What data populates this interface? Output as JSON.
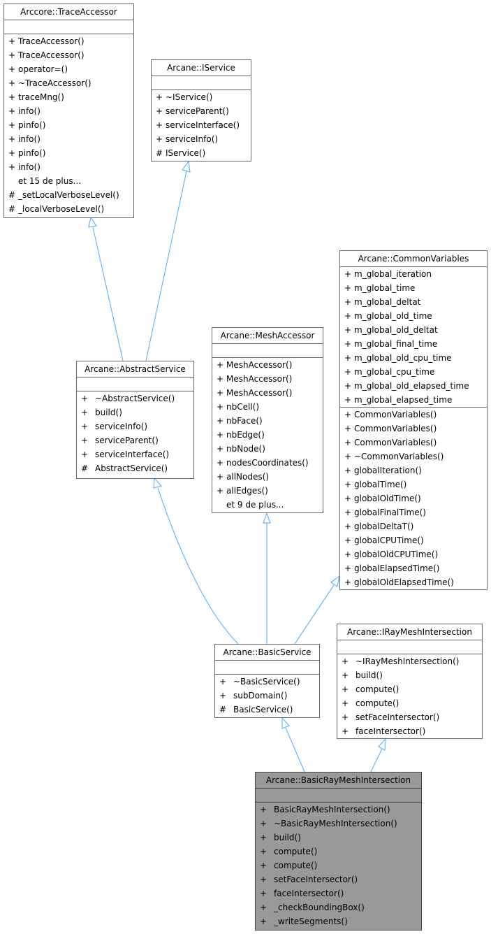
{
  "diagram": {
    "type": "class-inheritance",
    "edge_color": "#63b8ff",
    "classes": {
      "trace_accessor": {
        "name": "Arccore::TraceAccessor",
        "attributes": [],
        "methods": [
          {
            "vis": "+",
            "name": "TraceAccessor()"
          },
          {
            "vis": "+",
            "name": "TraceAccessor()"
          },
          {
            "vis": "+",
            "name": "operator=()"
          },
          {
            "vis": "+",
            "name": "~TraceAccessor()"
          },
          {
            "vis": "+",
            "name": "traceMng()"
          },
          {
            "vis": "+",
            "name": "info()"
          },
          {
            "vis": "+",
            "name": "pinfo()"
          },
          {
            "vis": "+",
            "name": "info()"
          },
          {
            "vis": "+",
            "name": "pinfo()"
          },
          {
            "vis": "+",
            "name": "info()"
          },
          {
            "vis": "",
            "name": "et 15 de plus..."
          },
          {
            "vis": "#",
            "name": "_setLocalVerboseLevel()"
          },
          {
            "vis": "#",
            "name": "_localVerboseLevel()"
          }
        ]
      },
      "iservice": {
        "name": "Arcane::IService",
        "attributes": [],
        "methods": [
          {
            "vis": "+",
            "name": "~IService()"
          },
          {
            "vis": "+",
            "name": "serviceParent()"
          },
          {
            "vis": "+",
            "name": "serviceInterface()"
          },
          {
            "vis": "+",
            "name": "serviceInfo()"
          },
          {
            "vis": "#",
            "name": "IService()"
          }
        ]
      },
      "common_variables": {
        "name": "Arcane::CommonVariables",
        "attributes": [
          {
            "vis": "+",
            "name": "m_global_iteration"
          },
          {
            "vis": "+",
            "name": "m_global_time"
          },
          {
            "vis": "+",
            "name": "m_global_deltat"
          },
          {
            "vis": "+",
            "name": "m_global_old_time"
          },
          {
            "vis": "+",
            "name": "m_global_old_deltat"
          },
          {
            "vis": "+",
            "name": "m_global_final_time"
          },
          {
            "vis": "+",
            "name": "m_global_old_cpu_time"
          },
          {
            "vis": "+",
            "name": "m_global_cpu_time"
          },
          {
            "vis": "+",
            "name": "m_global_old_elapsed_time"
          },
          {
            "vis": "+",
            "name": "m_global_elapsed_time"
          }
        ],
        "methods": [
          {
            "vis": "+",
            "name": "CommonVariables()"
          },
          {
            "vis": "+",
            "name": "CommonVariables()"
          },
          {
            "vis": "+",
            "name": "CommonVariables()"
          },
          {
            "vis": "+",
            "name": "~CommonVariables()"
          },
          {
            "vis": "+",
            "name": "globalIteration()"
          },
          {
            "vis": "+",
            "name": "globalTime()"
          },
          {
            "vis": "+",
            "name": "globalOldTime()"
          },
          {
            "vis": "+",
            "name": "globalFinalTime()"
          },
          {
            "vis": "+",
            "name": "globalDeltaT()"
          },
          {
            "vis": "+",
            "name": "globalCPUTime()"
          },
          {
            "vis": "+",
            "name": "globalOldCPUTime()"
          },
          {
            "vis": "+",
            "name": "globalElapsedTime()"
          },
          {
            "vis": "+",
            "name": "globalOldElapsedTime()"
          }
        ]
      },
      "mesh_accessor": {
        "name": "Arcane::MeshAccessor",
        "attributes": [],
        "methods": [
          {
            "vis": "+",
            "name": "MeshAccessor()"
          },
          {
            "vis": "+",
            "name": "MeshAccessor()"
          },
          {
            "vis": "+",
            "name": "MeshAccessor()"
          },
          {
            "vis": "+",
            "name": "nbCell()"
          },
          {
            "vis": "+",
            "name": "nbFace()"
          },
          {
            "vis": "+",
            "name": "nbEdge()"
          },
          {
            "vis": "+",
            "name": "nbNode()"
          },
          {
            "vis": "+",
            "name": "nodesCoordinates()"
          },
          {
            "vis": "+",
            "name": "allNodes()"
          },
          {
            "vis": "+",
            "name": "allEdges()"
          },
          {
            "vis": "",
            "name": "et 9 de plus..."
          }
        ]
      },
      "abstract_service": {
        "name": "Arcane::AbstractService",
        "attributes": [],
        "methods": [
          {
            "vis": "+",
            "name": "~AbstractService()"
          },
          {
            "vis": "+",
            "name": "build()"
          },
          {
            "vis": "+",
            "name": "serviceInfo()"
          },
          {
            "vis": "+",
            "name": "serviceParent()"
          },
          {
            "vis": "+",
            "name": "serviceInterface()"
          },
          {
            "vis": "#",
            "name": "AbstractService()"
          }
        ]
      },
      "basic_service": {
        "name": "Arcane::BasicService",
        "attributes": [],
        "methods": [
          {
            "vis": "+",
            "name": "~BasicService()"
          },
          {
            "vis": "+",
            "name": "subDomain()"
          },
          {
            "vis": "#",
            "name": "BasicService()"
          }
        ]
      },
      "iray_mesh_intersection": {
        "name": "Arcane::IRayMeshIntersection",
        "attributes": [],
        "methods": [
          {
            "vis": "+",
            "name": "~IRayMeshIntersection()"
          },
          {
            "vis": "+",
            "name": "build()"
          },
          {
            "vis": "+",
            "name": "compute()"
          },
          {
            "vis": "+",
            "name": "compute()"
          },
          {
            "vis": "+",
            "name": "setFaceIntersector()"
          },
          {
            "vis": "+",
            "name": "faceIntersector()"
          }
        ]
      },
      "basic_ray_mesh_intersection": {
        "name": "Arcane::BasicRayMeshIntersection",
        "highlighted": true,
        "attributes": [],
        "methods": [
          {
            "vis": "+",
            "name": "BasicRayMeshIntersection()"
          },
          {
            "vis": "+",
            "name": "~BasicRayMeshIntersection()"
          },
          {
            "vis": "+",
            "name": "build()"
          },
          {
            "vis": "+",
            "name": "compute()"
          },
          {
            "vis": "+",
            "name": "compute()"
          },
          {
            "vis": "+",
            "name": "setFaceIntersector()"
          },
          {
            "vis": "+",
            "name": "faceIntersector()"
          },
          {
            "vis": "+",
            "name": "_checkBoundingBox()"
          },
          {
            "vis": "+",
            "name": "_writeSegments()"
          }
        ]
      }
    },
    "inheritance": [
      {
        "child": "abstract_service",
        "parent": "trace_accessor"
      },
      {
        "child": "abstract_service",
        "parent": "iservice"
      },
      {
        "child": "basic_service",
        "parent": "abstract_service"
      },
      {
        "child": "basic_service",
        "parent": "mesh_accessor"
      },
      {
        "child": "basic_service",
        "parent": "common_variables"
      },
      {
        "child": "basic_ray_mesh_intersection",
        "parent": "basic_service"
      },
      {
        "child": "basic_ray_mesh_intersection",
        "parent": "iray_mesh_intersection"
      }
    ]
  }
}
